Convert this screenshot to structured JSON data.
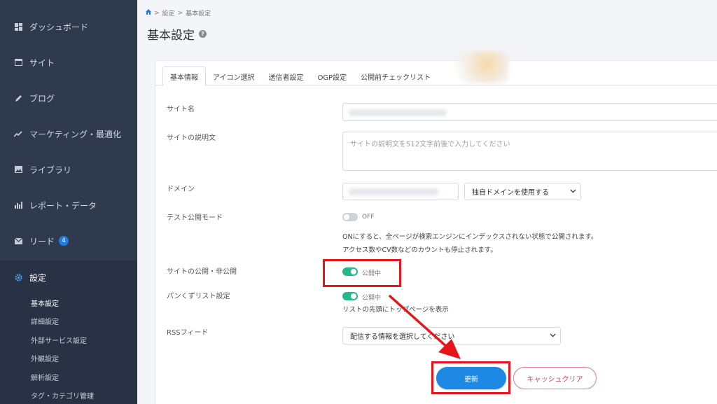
{
  "sidebar": {
    "items": [
      {
        "label": "ダッシュボード",
        "icon": "dashboard-icon"
      },
      {
        "label": "サイト",
        "icon": "site-icon"
      },
      {
        "label": "ブログ",
        "icon": "pencil-icon"
      },
      {
        "label": "マーケティング・最適化",
        "icon": "trend-icon"
      },
      {
        "label": "ライブラリ",
        "icon": "image-icon"
      },
      {
        "label": "レポート・データ",
        "icon": "bar-chart-icon"
      },
      {
        "label": "リード",
        "icon": "mail-icon",
        "badge": "4"
      },
      {
        "label": "設定",
        "icon": "gear-icon"
      }
    ],
    "sub_items": [
      "基本設定",
      "詳細設定",
      "外部サービス設定",
      "外観設定",
      "解析設定",
      "タグ・カテゴリ管理"
    ]
  },
  "breadcrumb": {
    "items": [
      "設定",
      "基本設定"
    ],
    "separator": ">"
  },
  "page": {
    "title": "基本設定"
  },
  "tabs": [
    "基本情報",
    "アイコン選択",
    "送信者設定",
    "OGP設定",
    "公開前チェックリスト"
  ],
  "form": {
    "site_name_label": "サイト名",
    "site_description_label": "サイトの説明文",
    "site_description_placeholder": "サイトの説明文を512文字前後で入力してください",
    "domain_label": "ドメイン",
    "domain_select": "独自ドメインを使用する",
    "test_mode_label": "テスト公開モード",
    "test_mode_state": "OFF",
    "test_mode_desc_1": "ONにすると、全ページが検索エンジンにインデックスされない状態で公開されます。",
    "test_mode_desc_2": "アクセス数やCV数などのカウントも停止されます。",
    "publish_label": "サイトの公開・非公開",
    "publish_state": "公開中",
    "breadcrumb_setting_label": "パンくずリスト設定",
    "breadcrumb_setting_state": "公開中",
    "breadcrumb_setting_desc": "リストの先頭にトップページを表示",
    "rss_label": "RSSフィード",
    "rss_select": "配信する情報を選択してください"
  },
  "buttons": {
    "update": "更新",
    "cache_clear": "キャッシュクリア"
  },
  "colors": {
    "sidebar": "#2f3a4e",
    "primary": "#1e88e5",
    "toggle_on": "#23b98b",
    "highlight": "#e8141c",
    "cache_button": "#d9434f"
  }
}
